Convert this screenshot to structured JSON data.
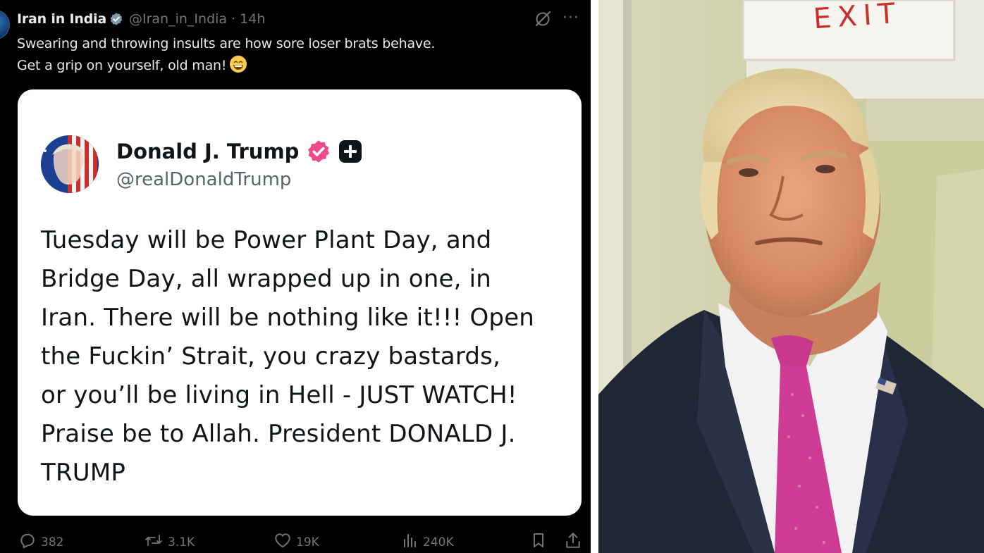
{
  "tweet": {
    "display_name": "Iran in India",
    "handle_time": "@Iran_in_India · 14h",
    "text_line1": "Swearing and throwing insults are how sore loser brats behave.",
    "text_line2": "Get a grip on yourself, old man!",
    "emoji": "grinning-face-emoji"
  },
  "quoted_post": {
    "name": "Donald J. Trump",
    "handle": "@realDonaldTrump",
    "lines": [
      "Tuesday will be Power Plant Day, and",
      "Bridge Day, all wrapped up in one, in",
      "Iran. There will be nothing like it!!! Open",
      "the Fuckin’ Strait, you crazy bastards,",
      "or you’ll be living in Hell - JUST WATCH!",
      "Praise be to Allah. President DONALD J.",
      "TRUMP"
    ]
  },
  "actions": {
    "replies": "382",
    "reposts": "3.1K",
    "likes": "19K",
    "views": "240K"
  },
  "photo": {
    "exit_sign": "EXIT",
    "description_icon": "man-in-suit-photo"
  },
  "colors": {
    "background": "#000000",
    "text_primary": "#e7e9ea",
    "text_secondary": "#71767b",
    "verified_pink": "#f04a8a",
    "exit_red": "#c8302c"
  }
}
